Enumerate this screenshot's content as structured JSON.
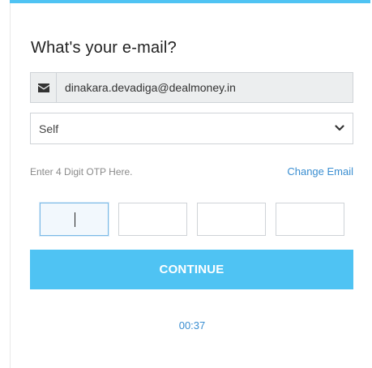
{
  "form": {
    "title": "What's your e-mail?",
    "email_value": "dinakara.devadiga@dealmoney.in",
    "email_icon": "envelope-icon",
    "relation_selected": "Self",
    "otp_label": "Enter 4 Digit OTP Here.",
    "change_email_label": "Change Email",
    "otp_digits": [
      "",
      "",
      "",
      ""
    ],
    "continue_label": "CONTINUE",
    "timer": "00:37"
  },
  "colors": {
    "accent": "#4fc3f3",
    "link": "#3a8ed1",
    "muted_text": "#8a8a8a",
    "input_border": "#cfd3d7"
  }
}
